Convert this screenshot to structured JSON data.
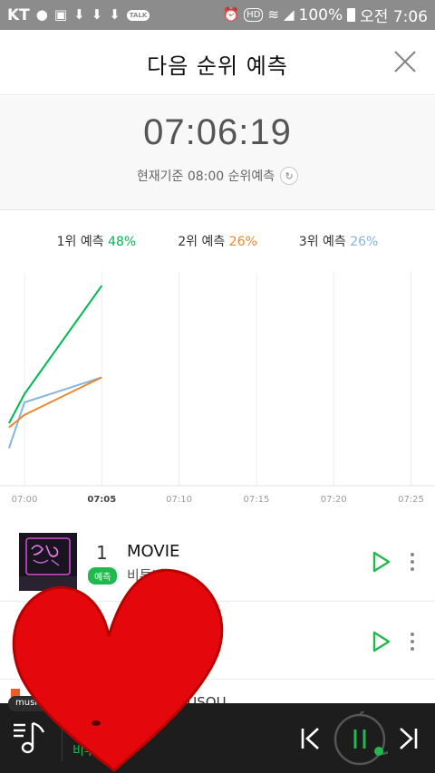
{
  "status_bar": {
    "carrier": "KT",
    "battery": "100%",
    "clock": "오전 7:06",
    "hd": "HD",
    "talk": "TALK"
  },
  "header": {
    "title": "다음 순위 예측"
  },
  "timer": {
    "time": "07:06:19",
    "subtitle": "현재기준 08:00 순위예측"
  },
  "legend": [
    {
      "label": "1위 예측",
      "pct": "48%",
      "color": "#00b84f"
    },
    {
      "label": "2위 예측",
      "pct": "26%",
      "color": "#f0862d"
    },
    {
      "label": "3위 예측",
      "pct": "26%",
      "color": "#84b4df"
    }
  ],
  "chart_data": {
    "type": "line",
    "x": [
      "07:00",
      "07:05",
      "07:10",
      "07:15",
      "07:20",
      "07:25"
    ],
    "current_tick": "07:05",
    "series": [
      {
        "name": "1위 예측",
        "color": "#00b84f",
        "points": [
          [
            "06:59",
            15
          ],
          [
            "07:00",
            22
          ],
          [
            "07:05",
            48
          ]
        ]
      },
      {
        "name": "2위 예측",
        "color": "#f0862d",
        "points": [
          [
            "06:59",
            14
          ],
          [
            "07:00",
            17
          ],
          [
            "07:05",
            26
          ]
        ]
      },
      {
        "name": "3위 예측",
        "color": "#84b4df",
        "points": [
          [
            "06:59",
            9
          ],
          [
            "07:00",
            20
          ],
          [
            "07:05",
            26
          ]
        ]
      }
    ],
    "ylim": [
      0,
      50
    ],
    "grid": "vertical"
  },
  "list": [
    {
      "rank": "1",
      "title": "MOVIE",
      "badge": "예측",
      "artist": "비투비"
    },
    {
      "rank": "2",
      "title": "",
      "badge": "",
      "artist": ""
    }
  ],
  "peek_row": {
    "text": "HUSOU"
  },
  "player": {
    "tab": "music",
    "sub_text": "비투"
  }
}
